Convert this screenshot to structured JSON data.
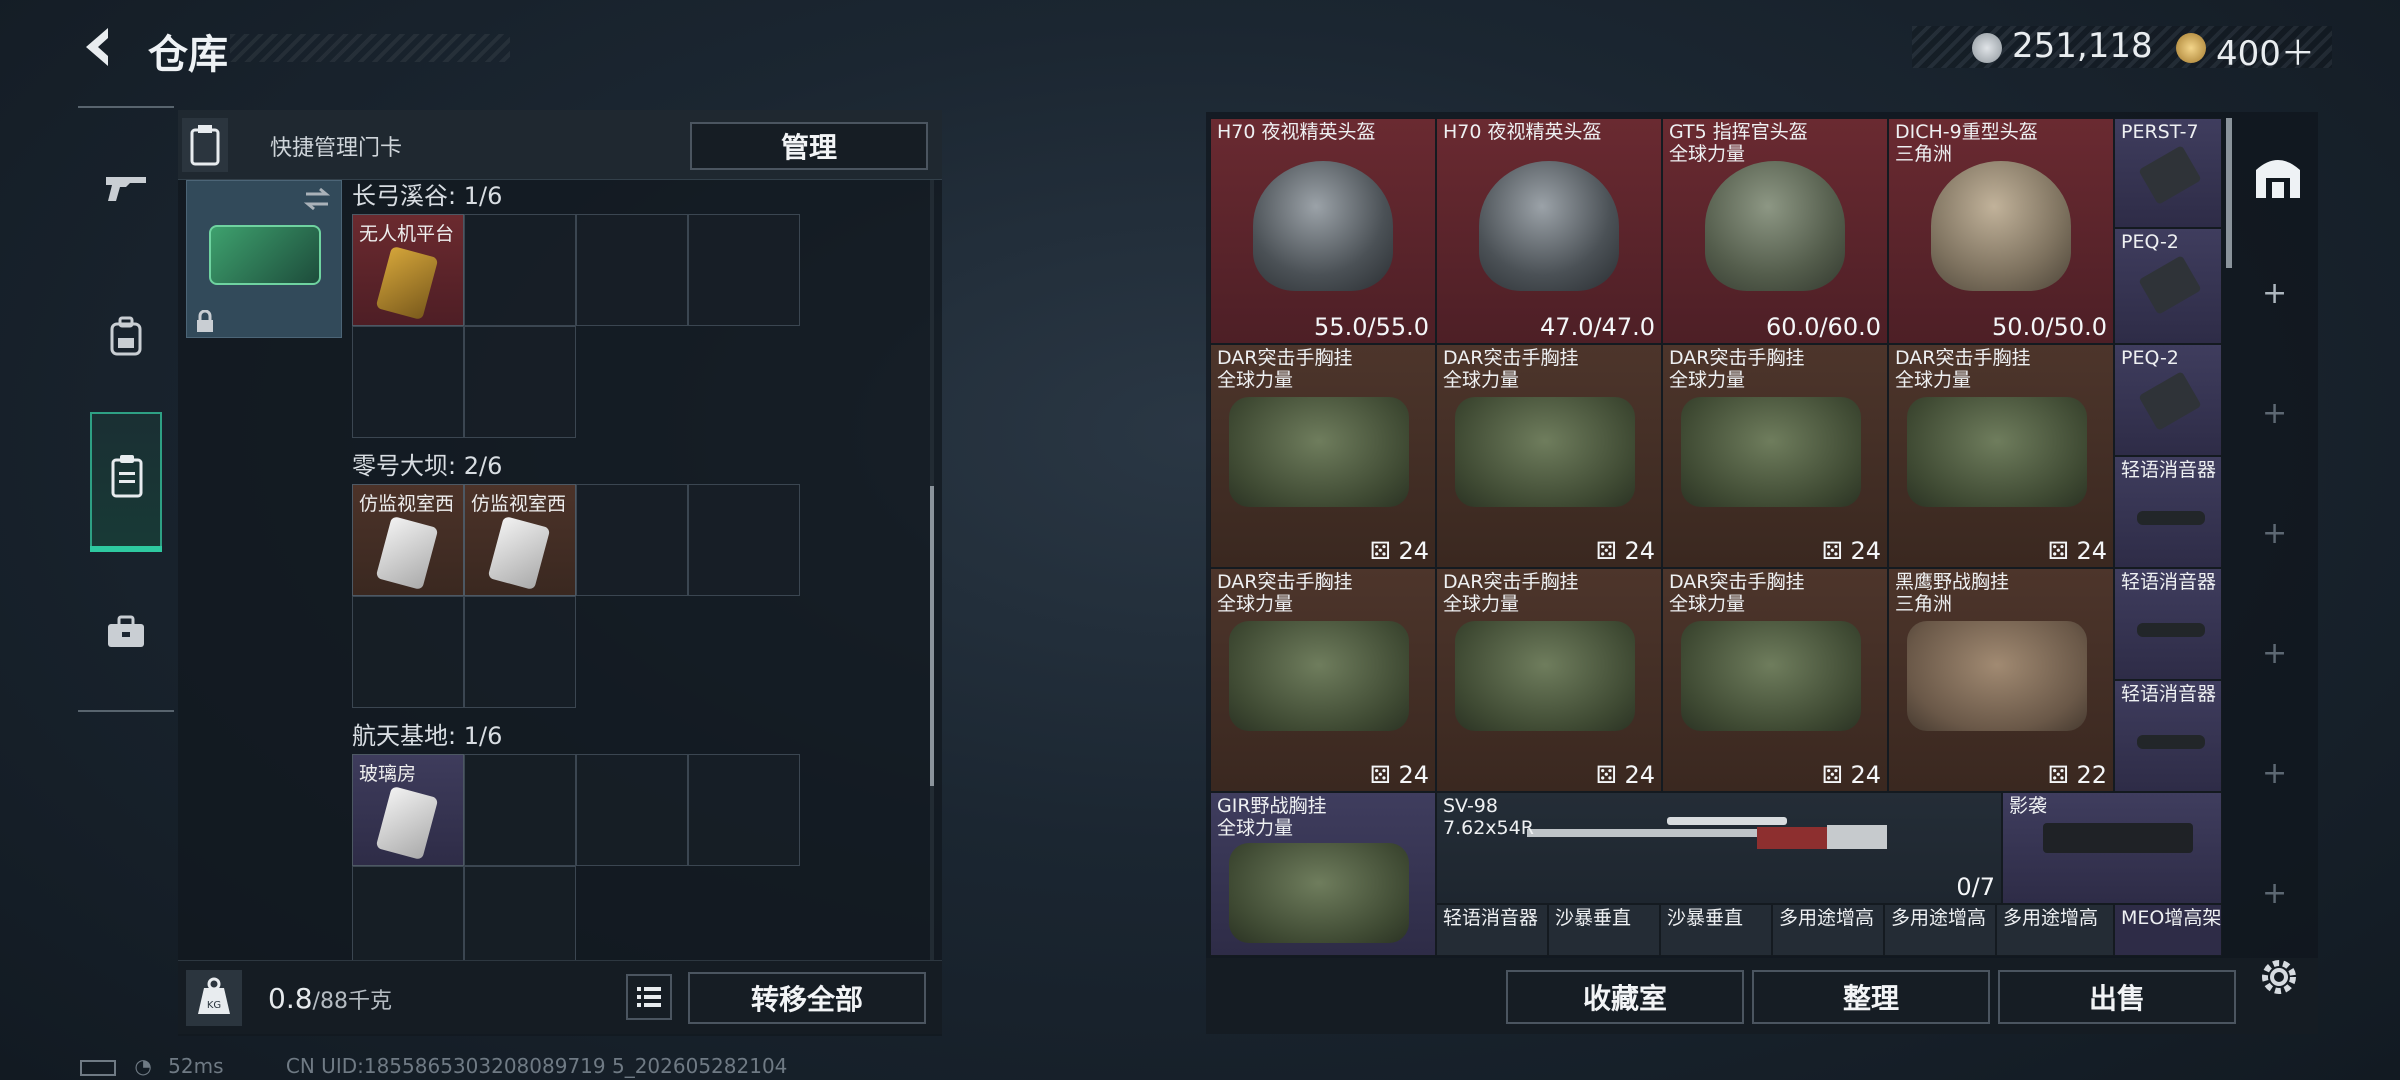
{
  "header": {
    "title": "仓库"
  },
  "currency": [
    {
      "icon": "silver-coin-icon",
      "value": "251,118"
    },
    {
      "icon": "gold-coin-icon",
      "value": "400＋"
    }
  ],
  "nav": [
    "gun-icon",
    "backpack-icon",
    "keycard-case-icon",
    "toolbox-icon"
  ],
  "card_panel": {
    "label": "快捷管理门卡",
    "manage_label": "管理"
  },
  "sections": [
    {
      "label": "长弓溪谷: 1/6",
      "items": [
        "无人机平台"
      ]
    },
    {
      "label": "零号大坝: 2/6",
      "items": [
        "仿监视室西",
        "仿监视室西"
      ]
    },
    {
      "label": "航天基地: 1/6",
      "items": [
        "玻璃房"
      ]
    }
  ],
  "bottom_left": {
    "weight_value": "0.8",
    "weight_max": "/88千克",
    "transfer_label": "转移全部"
  },
  "status": {
    "ping": "52ms",
    "uid": "CN UID:1855865303208089719 5_202605282104"
  },
  "inventory": {
    "row1": [
      {
        "name": "H70 夜视精英头盔",
        "sub": "",
        "value": "55.0/55.0",
        "rarity": "red"
      },
      {
        "name": "H70 夜视精英头盔",
        "sub": "",
        "value": "47.0/47.0",
        "rarity": "red"
      },
      {
        "name": "GT5 指挥官头盔",
        "sub": "全球力量",
        "value": "60.0/60.0",
        "rarity": "red"
      },
      {
        "name": "DICH-9重型头盔",
        "sub": "三角洲",
        "value": "50.0/50.0",
        "rarity": "red"
      }
    ],
    "row2": [
      {
        "name": "DAR突击手胸挂",
        "sub": "全球力量",
        "value": "24"
      },
      {
        "name": "DAR突击手胸挂",
        "sub": "全球力量",
        "value": "24"
      },
      {
        "name": "DAR突击手胸挂",
        "sub": "全球力量",
        "value": "24"
      },
      {
        "name": "DAR突击手胸挂",
        "sub": "全球力量",
        "value": "24"
      }
    ],
    "row3": [
      {
        "name": "DAR突击手胸挂",
        "sub": "全球力量",
        "value": "24"
      },
      {
        "name": "DAR突击手胸挂",
        "sub": "全球力量",
        "value": "24"
      },
      {
        "name": "DAR突击手胸挂",
        "sub": "全球力量",
        "value": "24"
      },
      {
        "name": "黑鹰野战胸挂",
        "sub": "三角洲",
        "value": "22"
      }
    ],
    "side_col": [
      "PERST-7",
      "PEQ-2",
      "PEQ-2",
      "轻语消音器",
      "轻语消音器",
      "轻语消音器",
      "MEO增高架"
    ],
    "row4": {
      "gir": {
        "name": "GIR野战胸挂",
        "sub": "全球力量"
      },
      "sv98": {
        "name": "SV-98",
        "sub": "7.62x54R",
        "value": "0/7"
      },
      "stock": {
        "name": "影袭"
      }
    },
    "row5": [
      "轻语消音器",
      "沙暴垂直",
      "沙暴垂直",
      "多用途增高",
      "多用途增高",
      "多用途增高"
    ]
  },
  "right_buttons": {
    "collection": "收藏室",
    "sort": "整理",
    "sell": "出售"
  },
  "colors": {
    "accent": "#2ec9a0",
    "rarity_red": "#6b2a2f",
    "rarity_brown": "#4c3329",
    "rarity_purple": "#3e3c5c"
  }
}
